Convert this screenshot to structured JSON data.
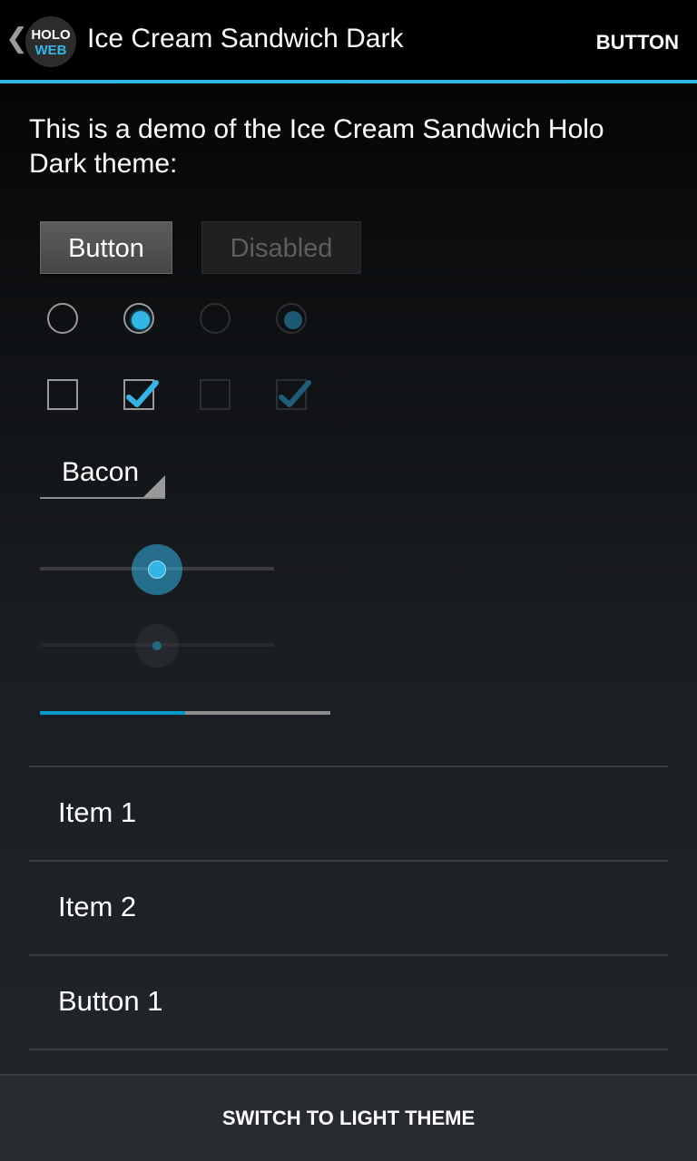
{
  "action_bar": {
    "logo_line1": "HOLO",
    "logo_line2": "WEB",
    "title": "Ice Cream Sandwich Dark",
    "action_label": "BUTTON",
    "up_icon": "chevron-left-icon",
    "accent_color": "#33b5e5"
  },
  "intro_text": "This is a demo of the Ice Cream Sandwich Holo Dark theme:",
  "buttons": {
    "normal_label": "Button",
    "disabled_label": "Disabled"
  },
  "radios": [
    {
      "state": "unchecked",
      "enabled": true
    },
    {
      "state": "checked",
      "enabled": true
    },
    {
      "state": "unchecked",
      "enabled": false
    },
    {
      "state": "checked",
      "enabled": false
    }
  ],
  "checkboxes": [
    {
      "state": "unchecked",
      "enabled": true
    },
    {
      "state": "checked",
      "enabled": true
    },
    {
      "state": "unchecked",
      "enabled": false
    },
    {
      "state": "checked",
      "enabled": false
    }
  ],
  "spinner": {
    "selected_value": "Bacon"
  },
  "seekbars": [
    {
      "value_fraction": 0.5,
      "enabled": true
    },
    {
      "value_fraction": 0.5,
      "enabled": false
    }
  ],
  "progress": {
    "value_fraction": 0.5,
    "fill_color": "#0099cc",
    "track_color": "#8d8d8d"
  },
  "list": {
    "items": [
      {
        "label": "Item 1"
      },
      {
        "label": "Item 2"
      },
      {
        "label": "Button 1"
      }
    ]
  },
  "bottom_bar": {
    "label": "SWITCH TO LIGHT THEME"
  }
}
